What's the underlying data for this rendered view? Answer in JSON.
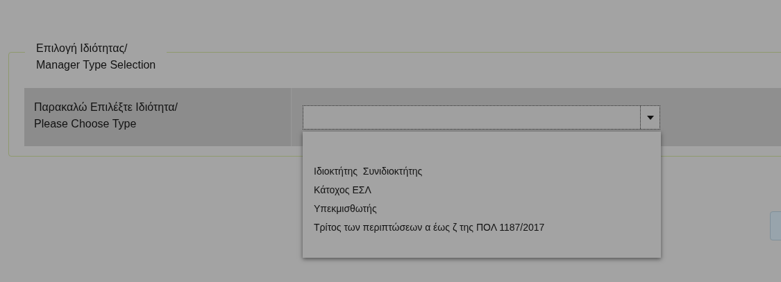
{
  "fieldset": {
    "legend": [
      "Επιλογή Ιδιότητας/",
      "Manager Type Selection"
    ],
    "field": {
      "label": [
        "Παρακαλώ Επιλέξτε Ιδιότητα/",
        "Please Choose Type"
      ],
      "dropdown": {
        "expanded": true,
        "options": [
          "Ιδιοκτήτης  Συνιδιοκτήτης",
          "Κάτοχος ΕΣΛ",
          "Υπεκμισθωτής",
          "Τρίτος των περιπτώσεων α έως ζ της ΠΟΛ 1187/2017"
        ]
      }
    }
  }
}
